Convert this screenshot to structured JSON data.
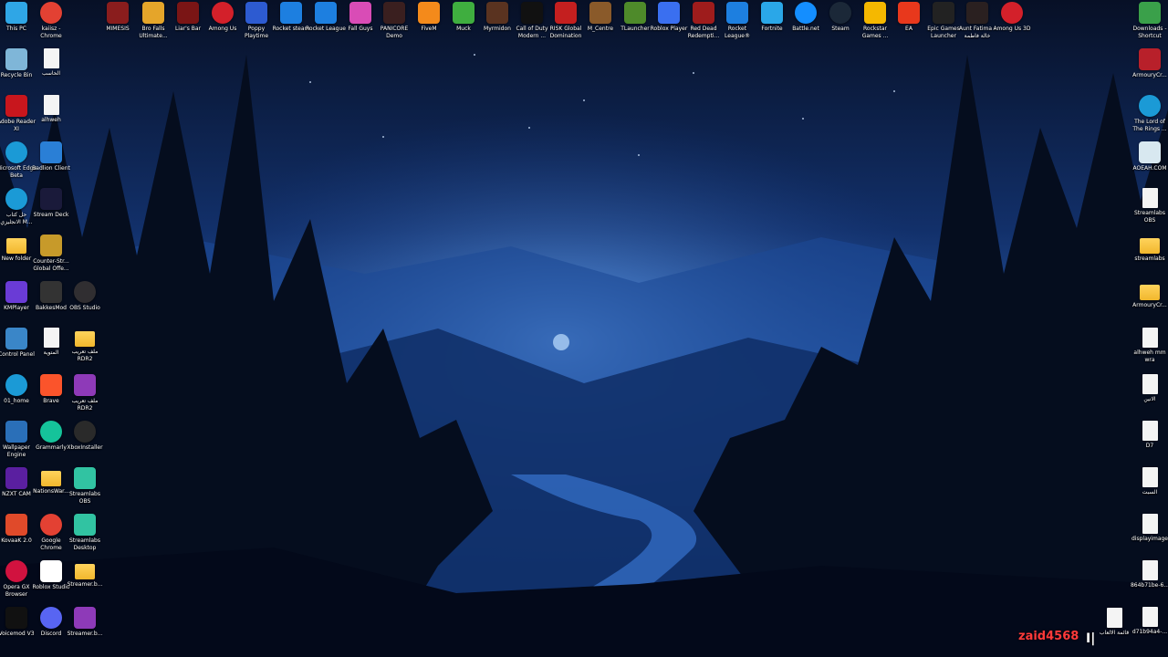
{
  "desktop": {
    "top_row": [
      {
        "label": "This PC",
        "icon": "monitor-icon",
        "color": "#2fa6e6"
      },
      {
        "label": "kaiisz - Chrome",
        "icon": "chrome-icon",
        "color": "#e34133"
      },
      {
        "label": "MIMESIS",
        "icon": "mimesis-icon",
        "color": "#8a1d1d"
      },
      {
        "label": "Bro Falls Ultimate...",
        "icon": "brofalls-icon",
        "color": "#e5a52a"
      },
      {
        "label": "Liar's Bar",
        "icon": "liarsbar-icon",
        "color": "#7a1515"
      },
      {
        "label": "Among Us",
        "icon": "amongus-icon",
        "color": "#d3202a"
      },
      {
        "label": "Poppy Playtime",
        "icon": "poppy-icon",
        "color": "#2d5bd1"
      },
      {
        "label": "Rocket steam",
        "icon": "rocketleague-icon",
        "color": "#1d7fe0"
      },
      {
        "label": "Rocket League",
        "icon": "rocketleague-icon",
        "color": "#1d7fe0"
      },
      {
        "label": "Fall Guys",
        "icon": "fallguys-icon",
        "color": "#d94cb6"
      },
      {
        "label": "PANICORE Demo",
        "icon": "panicore-icon",
        "color": "#3a1f1f"
      },
      {
        "label": "FiveM",
        "icon": "fivem-icon",
        "color": "#f48a1b"
      },
      {
        "label": "Muck",
        "icon": "muck-icon",
        "color": "#3fae3f"
      },
      {
        "label": "Myrmidon",
        "icon": "myrmidon-icon",
        "color": "#5a3320"
      },
      {
        "label": "Call of Duty Modern ...",
        "icon": "mw-icon",
        "color": "#111111"
      },
      {
        "label": "RISK Global Domination",
        "icon": "risk-icon",
        "color": "#c41f1f"
      },
      {
        "label": "M_Centre",
        "icon": "mcentre-icon",
        "color": "#8a5a2a"
      },
      {
        "label": "TLauncher",
        "icon": "tlauncher-icon",
        "color": "#4e8a2a"
      },
      {
        "label": "Roblox Player",
        "icon": "roblox-icon",
        "color": "#3a6ff0"
      },
      {
        "label": "Red Dead Redempti...",
        "icon": "rdr-icon",
        "color": "#9e1c1c"
      },
      {
        "label": "Rocket League®",
        "icon": "rocketleague-icon",
        "color": "#1d7fe0"
      },
      {
        "label": "Fortnite",
        "icon": "fortnite-icon",
        "color": "#2aa7e8"
      },
      {
        "label": "Battle.net",
        "icon": "battlenet-icon",
        "color": "#148eff"
      },
      {
        "label": "Steam",
        "icon": "steam-icon",
        "color": "#1b2838"
      },
      {
        "label": "Rockstar Games ...",
        "icon": "rockstar-icon",
        "color": "#f5b800"
      },
      {
        "label": "EA",
        "icon": "ea-icon",
        "color": "#e8381c"
      },
      {
        "label": "Epic Games Launcher",
        "icon": "epic-icon",
        "color": "#222222"
      },
      {
        "label": "Aunt Fatima - خالة فاطمة",
        "icon": "auntfatima-icon",
        "color": "#2a2020"
      },
      {
        "label": "Among Us 3D",
        "icon": "amongus-icon",
        "color": "#d3202a"
      }
    ],
    "left_col1": [
      {
        "label": "Recycle Bin",
        "icon": "recycle-bin-icon",
        "color": "#7fb6d8"
      },
      {
        "label": "Adobe Reader XI",
        "icon": "adobe-reader-icon",
        "color": "#c8161d"
      },
      {
        "label": "Microsoft Edge Beta",
        "icon": "edge-beta-icon",
        "color": "#1b9ad6"
      },
      {
        "label": "حل كتاب الانجليزي M...",
        "icon": "edge-icon",
        "color": "#1b9ad6"
      },
      {
        "label": "New folder",
        "icon": "folder-icon",
        "color": "#f1b72d"
      },
      {
        "label": "KMPlayer",
        "icon": "kmplayer-icon",
        "color": "#6a3bd6"
      },
      {
        "label": "Control Panel",
        "icon": "control-panel-icon",
        "color": "#3a86c8"
      },
      {
        "label": "01_home",
        "icon": "edge-icon",
        "color": "#1b9ad6"
      },
      {
        "label": "Wallpaper Engine",
        "icon": "wallpaper-engine-icon",
        "color": "#2a6fb8"
      },
      {
        "label": "NZXT CAM",
        "icon": "nzxt-icon",
        "color": "#5a1fa0"
      },
      {
        "label": "KovaaK 2.0",
        "icon": "kovaak-icon",
        "color": "#e04a2a"
      },
      {
        "label": "Opera GX Browser",
        "icon": "opera-gx-icon",
        "color": "#d1123f"
      },
      {
        "label": "Voicemod V3",
        "icon": "voicemod-icon",
        "color": "#111111"
      }
    ],
    "left_col2": [
      {
        "label": "الحاسب",
        "icon": "document-icon",
        "color": "#f4f4f4"
      },
      {
        "label": "alhweh",
        "icon": "document-icon",
        "color": "#f4f4f4"
      },
      {
        "label": "Badlion Client",
        "icon": "badlion-icon",
        "color": "#2a7fd6"
      },
      {
        "label": "Stream Deck",
        "icon": "stream-deck-icon",
        "color": "#1a1a3a"
      },
      {
        "label": "Counter-Str... Global Offe...",
        "icon": "csgo-icon",
        "color": "#c79a2a"
      },
      {
        "label": "BakkesMod",
        "icon": "bakkesmod-icon",
        "color": "#333333"
      },
      {
        "label": "المتوية",
        "icon": "document-icon",
        "color": "#f4f4f4"
      },
      {
        "label": "Brave",
        "icon": "brave-icon",
        "color": "#fb542b"
      },
      {
        "label": "Grammarly",
        "icon": "grammarly-icon",
        "color": "#15c39a"
      },
      {
        "label": "NationsWar...",
        "icon": "folder-icon",
        "color": "#f1b72d"
      },
      {
        "label": "Google Chrome",
        "icon": "chrome-icon",
        "color": "#e34133"
      },
      {
        "label": "Roblox Studio",
        "icon": "roblox-studio-icon",
        "color": "#ffffff"
      },
      {
        "label": "Discord",
        "icon": "discord-icon",
        "color": "#5865f2"
      }
    ],
    "left_col3": [
      {
        "label": "OBS Studio",
        "icon": "obs-icon",
        "color": "#302e31",
        "row": 6
      },
      {
        "label": "ملف تعريب RDR2",
        "icon": "folder-icon",
        "color": "#f1b72d",
        "row": 7
      },
      {
        "label": "ملف تعريب RDR2",
        "icon": "winrar-icon",
        "color": "#8e3ab8",
        "row": 8
      },
      {
        "label": "XboxInstaller",
        "icon": "xbox-icon",
        "color": "#2a2a2a",
        "row": 9
      },
      {
        "label": "Streamlabs OBS",
        "icon": "streamlabs-icon",
        "color": "#31c3a2",
        "row": 10
      },
      {
        "label": "Streamlabs Desktop",
        "icon": "streamlabs-icon",
        "color": "#31c3a2",
        "row": 11
      },
      {
        "label": "Streamer.b...",
        "icon": "folder-icon",
        "color": "#f1b72d",
        "row": 12
      },
      {
        "label": "Streamer.b...",
        "icon": "winrar-icon",
        "color": "#8e3ab8",
        "row": 13
      }
    ],
    "right_col": [
      {
        "label": "Downloads - Shortcut",
        "icon": "downloads-icon",
        "color": "#3aa04a"
      },
      {
        "label": "ArmouryCr...",
        "icon": "armoury-crate-icon",
        "color": "#b8202a"
      },
      {
        "label": "The Lord of The Rings ...",
        "icon": "edge-icon",
        "color": "#1b9ad6"
      },
      {
        "label": "AOEAH.COM",
        "icon": "aoeah-icon",
        "color": "#d8e8f0"
      },
      {
        "label": "Streamlabs OBS",
        "icon": "document-icon",
        "color": "#f4f4f4"
      },
      {
        "label": "streamlabs",
        "icon": "folder-icon",
        "color": "#f1b72d"
      },
      {
        "label": "ArmouryCr...",
        "icon": "folder-icon",
        "color": "#f1b72d"
      },
      {
        "label": "alhweh mm wra",
        "icon": "document-icon",
        "color": "#f4f4f4"
      },
      {
        "label": "الانين",
        "icon": "document-icon",
        "color": "#f4f4f4"
      },
      {
        "label": "D7",
        "icon": "document-icon",
        "color": "#f4f4f4"
      },
      {
        "label": "السبت",
        "icon": "document-icon",
        "color": "#f4f4f4"
      },
      {
        "label": "displayimage",
        "icon": "document-icon",
        "color": "#f4f4f4"
      },
      {
        "label": "864b71be-6...",
        "icon": "document-icon",
        "color": "#f4f4f4"
      },
      {
        "label": "d71b94a4-...",
        "icon": "document-icon",
        "color": "#f4f4f4"
      }
    ],
    "bottom_extra": {
      "label": "قائمة الالعاب",
      "icon": "document-icon",
      "color": "#f4f4f4"
    },
    "watermark": "zaid4568",
    "cursor_text": "I|"
  }
}
